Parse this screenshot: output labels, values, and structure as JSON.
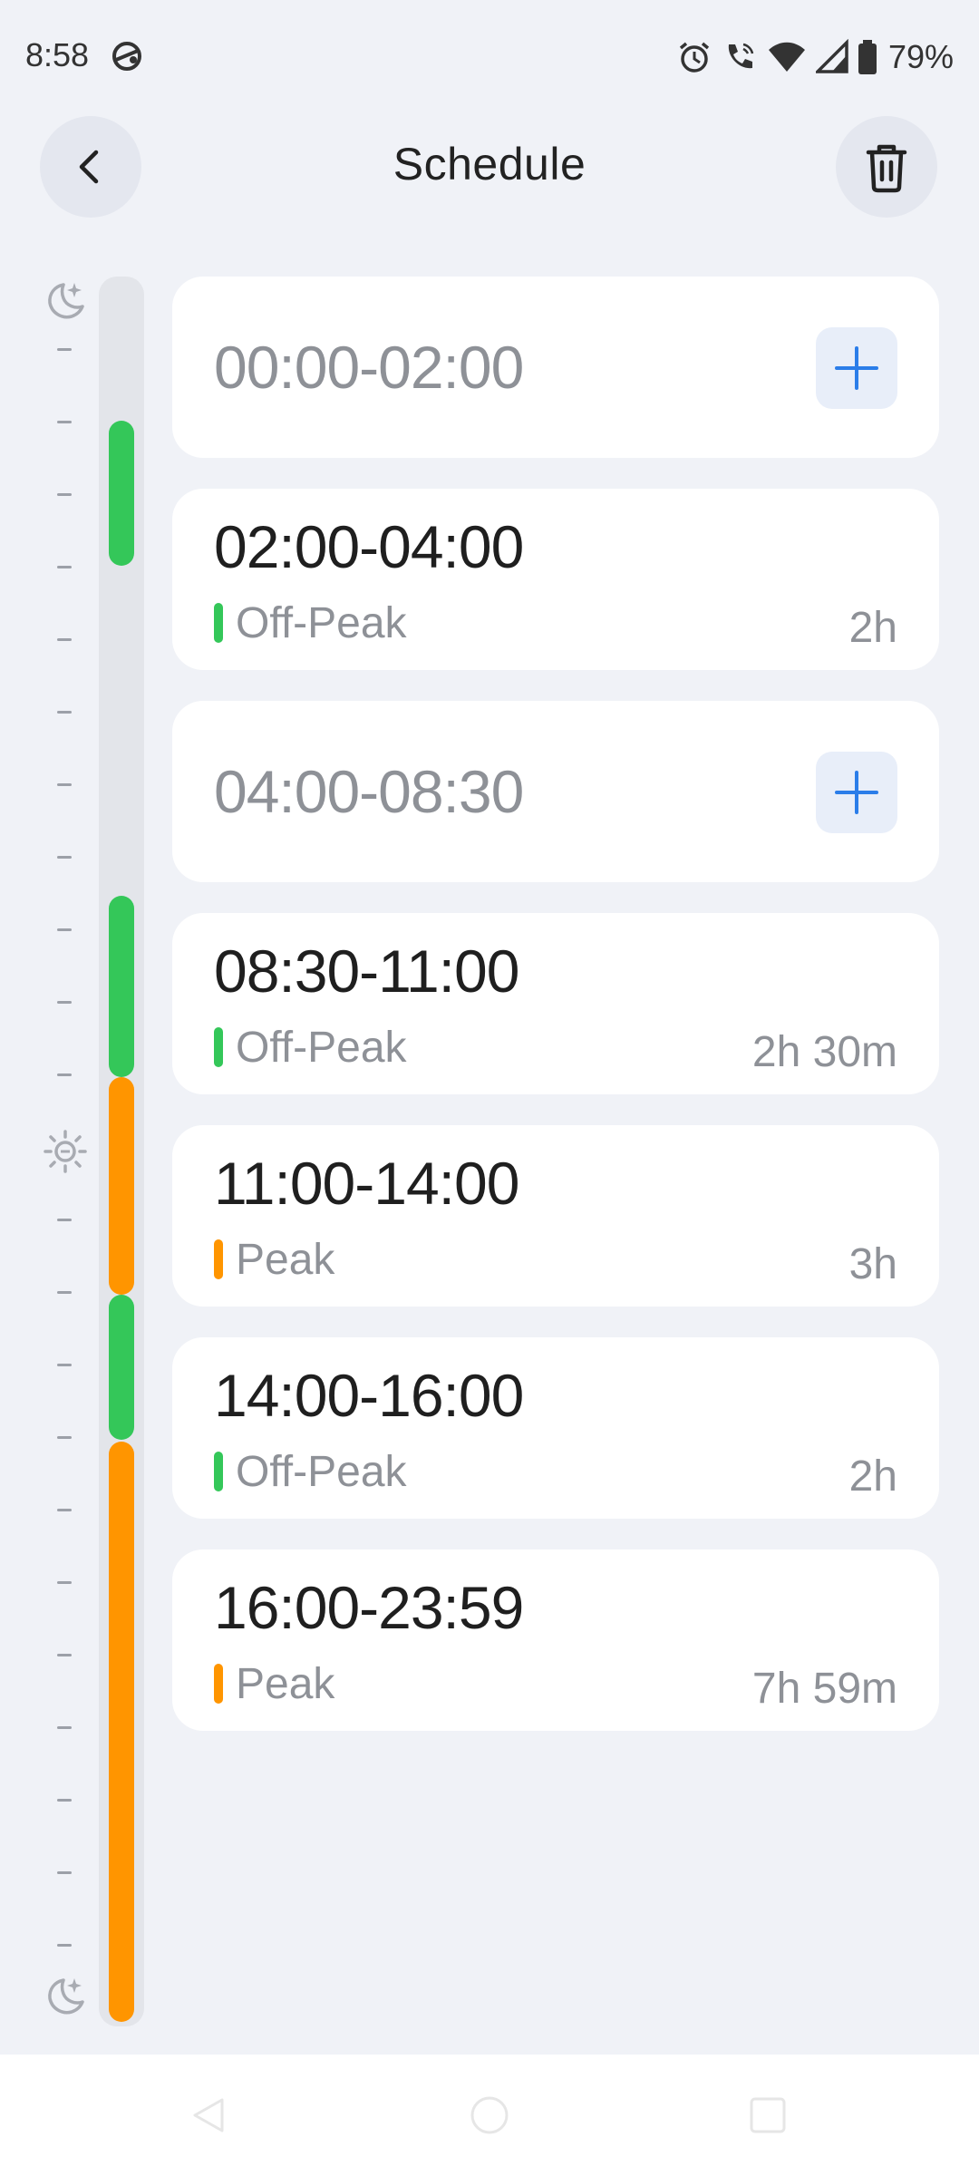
{
  "status_bar": {
    "time": "8:58",
    "battery_text": "79%",
    "icons": [
      "sync-icon",
      "alarm-icon",
      "wifi-call-icon",
      "wifi-icon",
      "cellular-signal-icon",
      "battery-icon"
    ]
  },
  "header": {
    "title": "Schedule",
    "back_icon": "chevron-left-icon",
    "delete_icon": "trash-icon"
  },
  "timeline": {
    "start_icon": "moon-icon",
    "mid_icon": "sun-icon",
    "end_icon": "moon-icon",
    "colors": {
      "off_peak": "#34c759",
      "peak": "#ff9500",
      "track": "#e3e5ea"
    }
  },
  "schedule": [
    {
      "range": "00:00-02:00",
      "empty": true
    },
    {
      "range": "02:00-04:00",
      "type": "Off-Peak",
      "duration": "2h",
      "color": "#34c759"
    },
    {
      "range": "04:00-08:30",
      "empty": true
    },
    {
      "range": "08:30-11:00",
      "type": "Off-Peak",
      "duration": "2h 30m",
      "color": "#34c759"
    },
    {
      "range": "11:00-14:00",
      "type": "Peak",
      "duration": "3h",
      "color": "#ff9500"
    },
    {
      "range": "14:00-16:00",
      "type": "Off-Peak",
      "duration": "2h",
      "color": "#34c759"
    },
    {
      "range": "16:00-23:59",
      "type": "Peak",
      "duration": "7h 59m",
      "color": "#ff9500"
    }
  ],
  "nav_bar": {
    "icons": [
      "back-nav-icon",
      "home-nav-icon",
      "recents-nav-icon"
    ]
  }
}
